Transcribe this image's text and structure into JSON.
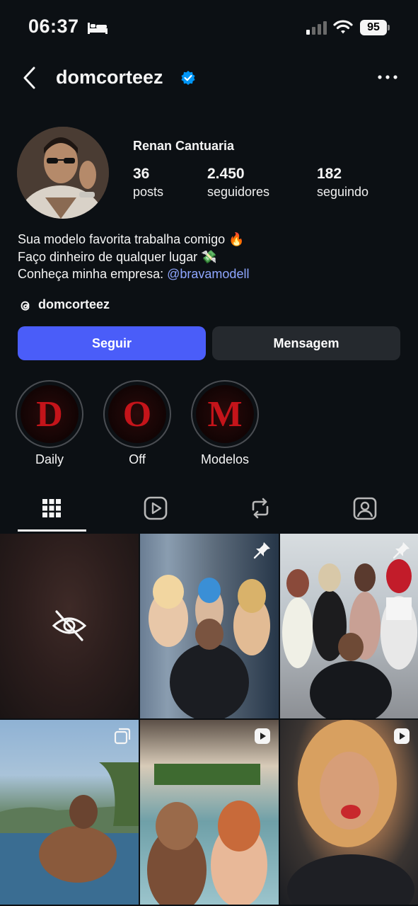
{
  "status_bar": {
    "time": "06:37",
    "battery": "95",
    "icons": [
      "bed-icon",
      "cellular-signal-icon",
      "wifi-icon",
      "battery-icon"
    ]
  },
  "header": {
    "username": "domcorteez",
    "icons": [
      "back-arrow-icon",
      "verified-badge-icon",
      "more-options-icon"
    ],
    "verified_color": "#0095f6"
  },
  "profile": {
    "display_name": "Renan Cantuaria",
    "stats": [
      {
        "value": "36",
        "label": "posts"
      },
      {
        "value": "2.450",
        "label": "seguidores"
      },
      {
        "value": "182",
        "label": "seguindo"
      }
    ],
    "bio_lines": [
      "Sua modelo favorita trabalha comigo 🔥",
      "Faço dinheiro de qualquer lugar 💸"
    ],
    "bio_link_prefix": "Conheça minha empresa: ",
    "bio_link": "@bravamodell",
    "threads_handle": "domcorteez"
  },
  "actions": {
    "follow_label": "Seguir",
    "message_label": "Mensagem",
    "follow_color": "#4a5df9",
    "message_color": "#25292e"
  },
  "highlights": [
    {
      "letter": "D",
      "label": "Daily"
    },
    {
      "letter": "O",
      "label": "Off"
    },
    {
      "letter": "M",
      "label": "Modelos"
    }
  ],
  "tabs": [
    {
      "name": "grid-icon",
      "active": true
    },
    {
      "name": "reels-icon",
      "active": false
    },
    {
      "name": "reposts-icon",
      "active": false
    },
    {
      "name": "tagged-icon",
      "active": false
    }
  ],
  "grid_posts": [
    {
      "badge": "hidden-eye-icon"
    },
    {
      "badge": "pin-icon"
    },
    {
      "badge": "pin-icon"
    },
    {
      "badge": "carousel-icon"
    },
    {
      "badge": "reel-icon"
    },
    {
      "badge": "reel-icon"
    }
  ],
  "colors": {
    "background": "#0c1014",
    "link": "#8ea6ff",
    "highlight_letter": "#c4141a"
  }
}
